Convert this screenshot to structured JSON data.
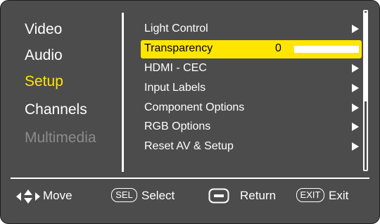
{
  "categories": [
    {
      "label": "Video",
      "state": "normal"
    },
    {
      "label": "Audio",
      "state": "normal"
    },
    {
      "label": "Setup",
      "state": "active"
    },
    {
      "label": "Channels",
      "state": "normal"
    },
    {
      "label": "Multimedia",
      "state": "disabled"
    }
  ],
  "submenu": [
    {
      "label": "Light Control",
      "arrow": true
    },
    {
      "label": "Transparency",
      "value": "0",
      "slider_level": 1.0,
      "selected": true
    },
    {
      "label": "HDMI - CEC",
      "arrow": true
    },
    {
      "label": "Input Labels",
      "arrow": true
    },
    {
      "label": "Component Options",
      "arrow": true
    },
    {
      "label": "RGB Options",
      "arrow": true
    },
    {
      "label": "Reset AV & Setup",
      "arrow": true
    }
  ],
  "footer": {
    "move_label": "Move",
    "select_key": "SEL",
    "select_label": "Select",
    "return_label": "Return",
    "exit_key": "EXIT",
    "exit_label": "Exit"
  },
  "colors": {
    "background": "#4c4c4c",
    "highlight": "#ffe600",
    "text": "#ffffff",
    "disabled_text": "#8b8b8b"
  },
  "icons": {
    "move": "four-way-arrows-icon",
    "return": "minus-button-icon",
    "submenu_arrow": "right-triangle-icon"
  }
}
